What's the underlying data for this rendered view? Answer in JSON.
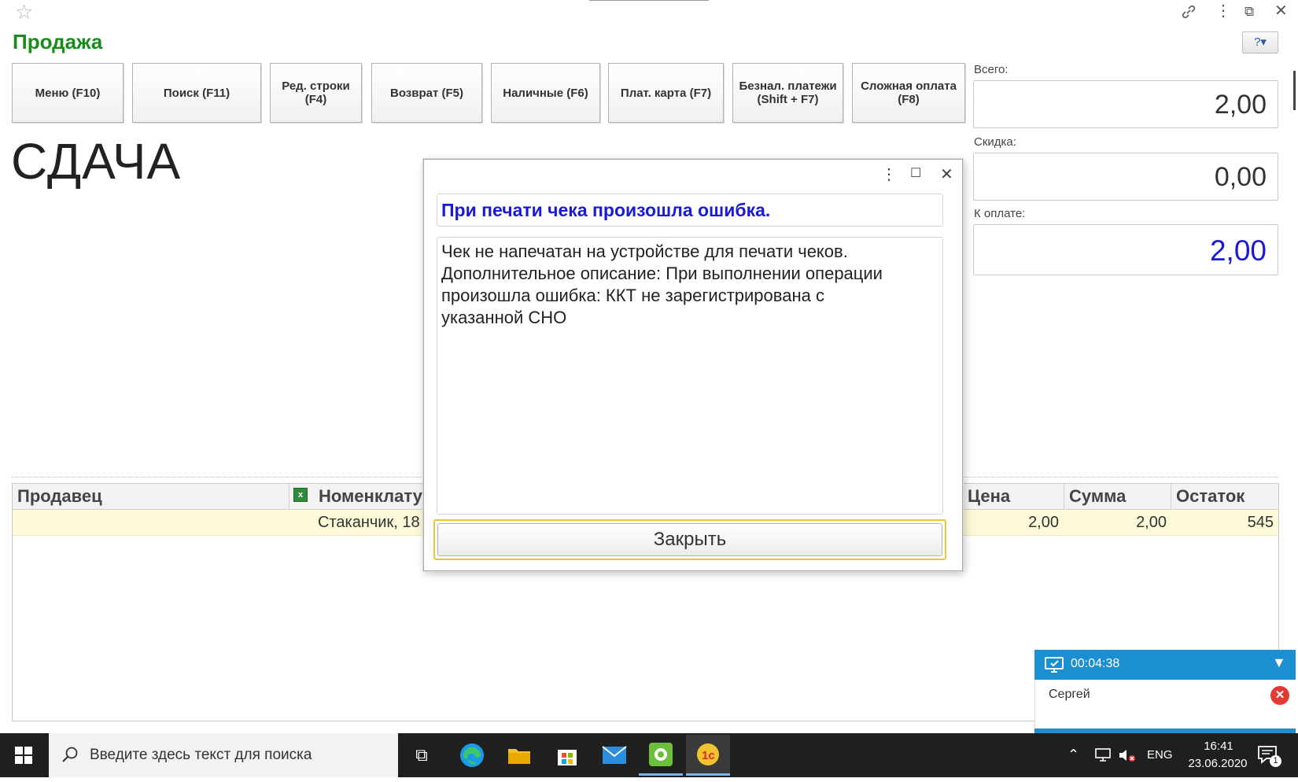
{
  "page": {
    "title": "Продажа",
    "big_label": "СДАЧА",
    "help_button": "?▾"
  },
  "toolbar": [
    {
      "label": "Меню (F10)"
    },
    {
      "label": "Поиск (F11)"
    },
    {
      "label": "Ред. строки (F4)"
    },
    {
      "label": "Возврат (F5)"
    },
    {
      "label": "Наличные (F6)"
    },
    {
      "label": "Плат. карта (F7)"
    },
    {
      "label": "Безнал. платежи (Shift + F7)"
    },
    {
      "label": "Сложная оплата (F8)"
    }
  ],
  "totals": {
    "total_label": "Всего:",
    "total_value": "2,00",
    "discount_label": "Скидка:",
    "discount_value": "0,00",
    "to_pay_label": "К оплате:",
    "to_pay_value": "2,00",
    "to_pay_color": "#1a1ad6"
  },
  "table": {
    "headers": [
      "Продавец",
      "Номенклату",
      "Цена",
      "Сумма",
      "Остаток"
    ],
    "rows": [
      {
        "seller": "",
        "item": "Стаканчик, 18",
        "price": "2,00",
        "sum": "2,00",
        "stock": "545"
      }
    ]
  },
  "dialog": {
    "title": "При печати чека произошла ошибка.",
    "message": "Чек не напечатан на устройстве для печати чеков.\nДополнительное описание: При выполнении операции\nпроизошла ошибка: ККТ не зарегистрирована с\nуказанной СНО",
    "close_button": "Закрыть"
  },
  "remote_session": {
    "timer": "00:04:38",
    "user": "Сергей",
    "color": "#1c8fd3"
  },
  "taskbar": {
    "search_placeholder": "Введите здесь текст для поиска",
    "language": "ENG",
    "time": "16:41",
    "date": "23.06.2020",
    "notification_count": "1"
  },
  "colors": {
    "title_green": "#1a8c1a",
    "dialog_title_blue": "#1a1ad6",
    "row_highlight": "#fbf9d7",
    "focus_yellow": "#f2c230"
  }
}
